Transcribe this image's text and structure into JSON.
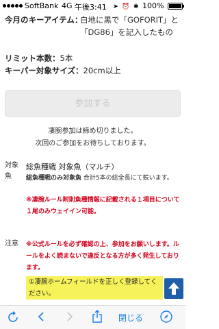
{
  "status_bar": {
    "carrier": "SoftBank",
    "network": "4G",
    "time": "午後3:41",
    "battery": "100%",
    "battery_level": 1.0
  },
  "info": {
    "keeper_item_label": "今月のキーアイテム：",
    "keeper_item_value": "白地に黒で「GOFORIT」と「DG86」を記入したもの",
    "limit_label": "リミット本数：",
    "limit_value": "5本",
    "size_label": "キーパー対象サイズ：",
    "size_value": "20cm以上"
  },
  "join_button": {
    "label": "参加する"
  },
  "closed_message": {
    "line1": "凄腕参加は締め切りました。",
    "line2": "次回のご参加をお待ちしております。"
  },
  "target": {
    "label": "対象魚",
    "heading": "総魚種戦 対象魚（マルチ）",
    "desc_bold": "総魚種戦のみ対象魚",
    "desc_rest": " 合計5本の総全長にて競います。",
    "red_text": "※凄腕ルール附則魚種情報に記載される１項目について１尾のみウェイイン可能。"
  },
  "note": {
    "label": "注意",
    "red_text": "※公式ルールを必ず確認の上、参加をお願いします。ルールをよく読まないで違反となる方が多く発生しております。",
    "highlight_text": "①凄腕ホームフィールドを正しく登録してください。"
  },
  "toolbar": {
    "close_label": "閉じる"
  },
  "colors": {
    "link_blue": "#1a7cf5",
    "red": "#d0021b",
    "highlight": "#f6f35a",
    "scroll_button": "#1f5fa8"
  }
}
